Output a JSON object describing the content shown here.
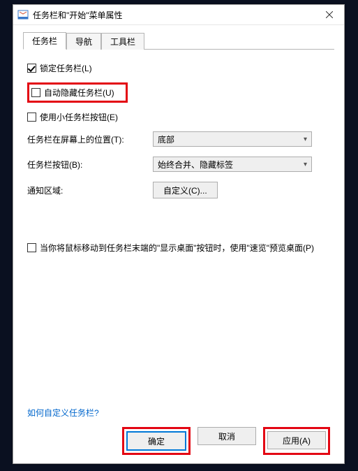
{
  "window": {
    "title": "任务栏和\"开始\"菜单属性"
  },
  "tabs": {
    "taskbar": "任务栏",
    "navigation": "导航",
    "toolbars": "工具栏"
  },
  "options": {
    "lock_taskbar": "锁定任务栏(L)",
    "auto_hide": "自动隐藏任务栏(U)",
    "small_buttons": "使用小任务栏按钮(E)",
    "peek_desktop": "当你将鼠标移动到任务栏末端的\"显示桌面\"按钮时，使用\"速览\"预览桌面(P)"
  },
  "form": {
    "position_label": "任务栏在屏幕上的位置(T):",
    "position_value": "底部",
    "buttons_label": "任务栏按钮(B):",
    "buttons_value": "始终合并、隐藏标签",
    "notify_label": "通知区域:",
    "customize_btn": "自定义(C)..."
  },
  "link": {
    "how_customize": "如何自定义任务栏?"
  },
  "actions": {
    "ok": "确定",
    "cancel": "取消",
    "apply": "应用(A)"
  }
}
